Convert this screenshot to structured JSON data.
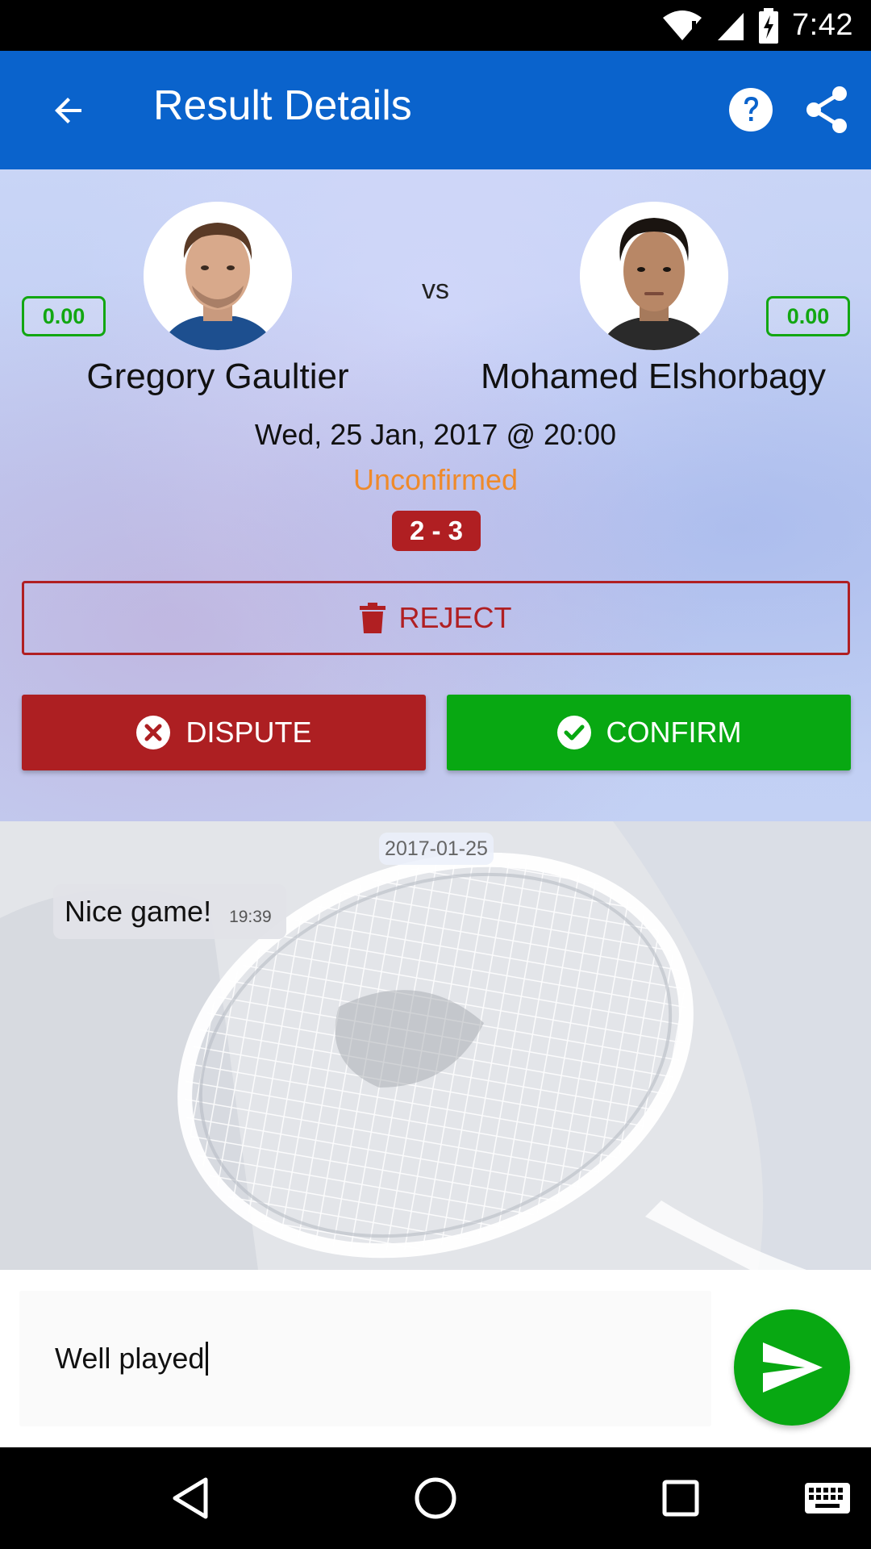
{
  "status_bar": {
    "time": "7:42"
  },
  "app_bar": {
    "title": "Result Details",
    "back_icon": "arrow-back-icon",
    "help_icon": "help-icon",
    "share_icon": "share-icon"
  },
  "match": {
    "player_left": {
      "name": "Gregory Gaultier",
      "rating": "0.00"
    },
    "player_right": {
      "name": "Mohamed Elshorbagy",
      "rating": "0.00"
    },
    "vs_label": "vs",
    "date": "Wed, 25 Jan, 2017 @ 20:00",
    "status": "Unconfirmed",
    "score": "2 - 3"
  },
  "actions": {
    "reject_label": "REJECT",
    "dispute_label": "DISPUTE",
    "confirm_label": "CONFIRM"
  },
  "chat": {
    "date_chip": "2017-01-25",
    "messages": [
      {
        "text": "Nice game!",
        "time": "19:39"
      }
    ]
  },
  "composer": {
    "value": "Well played"
  },
  "colors": {
    "app_bar": "#0a63cc",
    "reject": "#b01f22",
    "dispute": "#ad1f22",
    "confirm": "#08a812",
    "status_unconfirmed": "#ef8a2a",
    "rating": "#12a712"
  }
}
